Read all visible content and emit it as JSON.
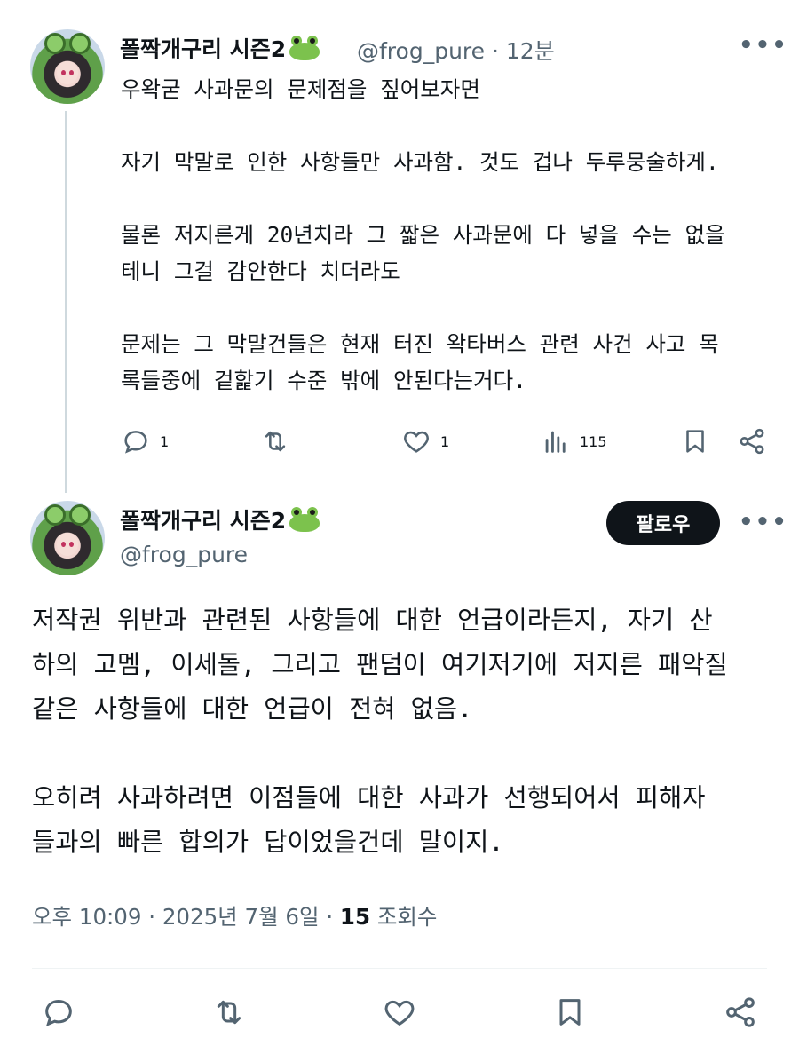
{
  "reply": {
    "display_name": "폴짝개구리 시즌2",
    "handle": "@frog_pure",
    "time": "12분",
    "text": "우왁굳 사과문의 문제점을 짚어보자면\n\n자기 막말로 인한 사항들만 사과함. 것도 겁나 두루뭉술하게.\n\n물론 저지른게 20년치라 그 짧은 사과문에 다 넣을 수는 없을\n테니 그걸 감안한다 치더라도\n\n문제는 그 막말건들은 현재 터진 왁타버스 관련 사건 사고 목\n록들중에 겉핥기 수준 밖에 안된다는거다.",
    "replies_count": "1",
    "likes_count": "1",
    "views_count": "115"
  },
  "main": {
    "display_name": "폴짝개구리 시즌2",
    "handle": "@frog_pure",
    "follow_label": "팔로우",
    "text": "저작권 위반과 관련된 사항들에 대한 언급이라든지, 자기 산\n하의 고멤, 이세돌, 그리고 팬덤이 여기저기에 저지른 패악질\n같은 사항들에 대한 언급이 전혀 없음.\n\n오히려 사과하려면 이점들에 대한 사과가 선행되어서 피해자\n들과의 빠른 합의가 답이었을건데 말이지.",
    "timestamp": "오후 10:09 · 2025년 7월 6일 · ",
    "views_count": "15",
    "views_label": " 조회수"
  },
  "icons": [
    "reply-icon",
    "retweet-icon",
    "like-icon",
    "views-icon",
    "bookmark-icon",
    "share-icon",
    "more-icon",
    "frog-emoji-icon"
  ],
  "colors": {
    "text": "#0f1419",
    "muted": "#536471",
    "follow_bg": "#0f1419",
    "line": "#cfd9de"
  }
}
